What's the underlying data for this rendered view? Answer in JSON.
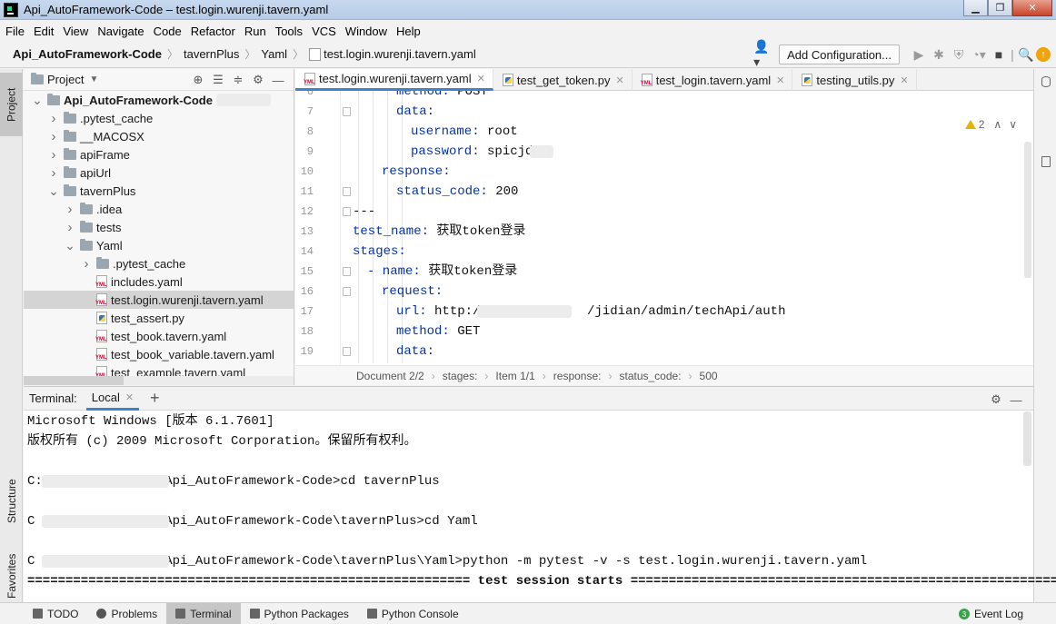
{
  "window": {
    "title": "Api_AutoFramework-Code – test.login.wurenji.tavern.yaml"
  },
  "menu": [
    "File",
    "Edit",
    "View",
    "Navigate",
    "Code",
    "Refactor",
    "Run",
    "Tools",
    "VCS",
    "Window",
    "Help"
  ],
  "breadcrumb": [
    "Api_AutoFramework-Code",
    "tavernPlus",
    "Yaml",
    "test.login.wurenji.tavern.yaml"
  ],
  "toolbar": {
    "add_config": "Add Configuration..."
  },
  "side_tabs": {
    "project": "Project",
    "structure": "Structure",
    "favorites": "Favorites"
  },
  "project_panel": {
    "title": "Project",
    "tree": [
      {
        "label": "Api_AutoFramework-Code",
        "depth": 0,
        "type": "folder",
        "expanded": true,
        "bold": true
      },
      {
        "label": ".pytest_cache",
        "depth": 1,
        "type": "folder",
        "expanded": false
      },
      {
        "label": "__MACOSX",
        "depth": 1,
        "type": "folder",
        "expanded": false
      },
      {
        "label": "apiFrame",
        "depth": 1,
        "type": "folder",
        "expanded": false
      },
      {
        "label": "apiUrl",
        "depth": 1,
        "type": "folder",
        "expanded": false
      },
      {
        "label": "tavernPlus",
        "depth": 1,
        "type": "folder",
        "expanded": true
      },
      {
        "label": ".idea",
        "depth": 2,
        "type": "folder",
        "expanded": false
      },
      {
        "label": "tests",
        "depth": 2,
        "type": "folder",
        "expanded": false
      },
      {
        "label": "Yaml",
        "depth": 2,
        "type": "folder",
        "expanded": true
      },
      {
        "label": ".pytest_cache",
        "depth": 3,
        "type": "folder",
        "expanded": false
      },
      {
        "label": "includes.yaml",
        "depth": 3,
        "type": "yml"
      },
      {
        "label": "test.login.wurenji.tavern.yaml",
        "depth": 3,
        "type": "yml",
        "selected": true
      },
      {
        "label": "test_assert.py",
        "depth": 3,
        "type": "py"
      },
      {
        "label": "test_book.tavern.yaml",
        "depth": 3,
        "type": "yml"
      },
      {
        "label": "test_book_variable.tavern.yaml",
        "depth": 3,
        "type": "yml"
      },
      {
        "label": "test_example.tavern.yaml",
        "depth": 3,
        "type": "yml"
      }
    ]
  },
  "editor": {
    "tabs": [
      {
        "label": "test.login.wurenji.tavern.yaml",
        "type": "yml",
        "active": true
      },
      {
        "label": "test_get_token.py",
        "type": "py"
      },
      {
        "label": "test_login.tavern.yaml",
        "type": "yml"
      },
      {
        "label": "testing_utils.py",
        "type": "py"
      }
    ],
    "warnings": "2",
    "lines": [
      {
        "n": "6",
        "indent": 3,
        "key": "method:",
        "val": " POST"
      },
      {
        "n": "7",
        "indent": 3,
        "key": "data:",
        "val": ""
      },
      {
        "n": "8",
        "indent": 4,
        "key": "username:",
        "val": " root"
      },
      {
        "n": "9",
        "indent": 4,
        "key": "password:",
        "val": " spicjd@"
      },
      {
        "n": "10",
        "indent": 2,
        "key": "response:",
        "val": ""
      },
      {
        "n": "11",
        "indent": 3,
        "key": "status_code:",
        "val": " 200"
      },
      {
        "n": "12",
        "indent": 0,
        "key": "",
        "val": "---"
      },
      {
        "n": "13",
        "indent": 0,
        "key": "test_name:",
        "val": " 获取token登录"
      },
      {
        "n": "14",
        "indent": 0,
        "key": "stages:",
        "val": ""
      },
      {
        "n": "15",
        "indent": 1,
        "key": "- name:",
        "val": " 获取token登录"
      },
      {
        "n": "16",
        "indent": 2,
        "key": "request:",
        "val": ""
      },
      {
        "n": "17",
        "indent": 3,
        "key": "url:",
        "val": " http:/              /jidian/admin/techApi/auth"
      },
      {
        "n": "18",
        "indent": 3,
        "key": "method:",
        "val": " GET"
      },
      {
        "n": "19",
        "indent": 3,
        "key": "data:",
        "val": ""
      }
    ],
    "breadcrumb": [
      "Document 2/2",
      "stages:",
      "Item 1/1",
      "response:",
      "status_code:",
      "500"
    ]
  },
  "terminal": {
    "title": "Terminal:",
    "tab": "Local",
    "lines": [
      {
        "text": "Microsoft Windows [版本 6.1.7601]",
        "row": 0
      },
      {
        "text": "版权所有 (c) 2009 Microsoft Corporation。保留所有权利。",
        "row": 1
      },
      {
        "text": "C:               \\Api_AutoFramework-Code>cd tavernPlus",
        "row": 3
      },
      {
        "text": "C                \\Api_AutoFramework-Code\\tavernPlus>cd Yaml",
        "row": 5
      },
      {
        "text": "C                \\Api_AutoFramework-Code\\tavernPlus\\Yaml>python -m pytest -v -s test.login.wurenji.tavern.yaml",
        "row": 7
      },
      {
        "text": "========================================================== test session starts ==========================================================",
        "row": 8,
        "bold": true
      }
    ]
  },
  "statusbar": {
    "items": [
      {
        "label": "TODO"
      },
      {
        "label": "Problems"
      },
      {
        "label": "Terminal",
        "active": true
      },
      {
        "label": "Python Packages"
      },
      {
        "label": "Python Console"
      }
    ],
    "event_log": "Event Log",
    "event_count": "3"
  }
}
